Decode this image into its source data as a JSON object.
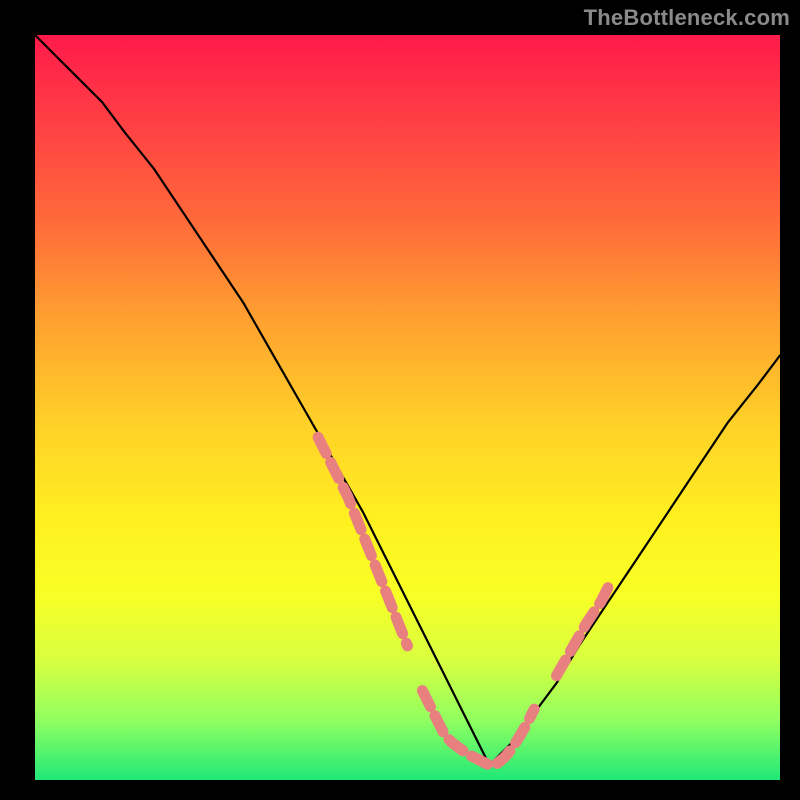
{
  "watermark": "TheBottleneck.com",
  "chart_data": {
    "type": "line",
    "title": "",
    "xlabel": "",
    "ylabel": "",
    "xlim": [
      0,
      100
    ],
    "ylim": [
      0,
      100
    ],
    "series": [
      {
        "name": "left-curve",
        "x": [
          0,
          3,
          6,
          9,
          12,
          16,
          20,
          24,
          28,
          32,
          36,
          40,
          44,
          48,
          52,
          55,
          57,
          59,
          61
        ],
        "y": [
          100,
          97,
          94,
          91,
          87,
          82,
          76,
          70,
          64,
          57,
          50,
          43,
          36,
          28,
          20,
          14,
          10,
          6,
          2
        ]
      },
      {
        "name": "right-curve",
        "x": [
          61,
          64,
          67,
          70,
          73,
          77,
          81,
          85,
          89,
          93,
          97,
          100
        ],
        "y": [
          2,
          5,
          9,
          13,
          18,
          24,
          30,
          36,
          42,
          48,
          53,
          57
        ]
      },
      {
        "name": "highlight-left-descent",
        "x": [
          38,
          40,
          42,
          44,
          46,
          48,
          50
        ],
        "y": [
          46,
          42,
          38,
          33,
          28,
          23,
          18
        ]
      },
      {
        "name": "highlight-valley",
        "x": [
          52,
          54,
          55,
          56,
          58,
          60,
          61,
          62,
          63,
          64,
          65,
          66,
          67
        ],
        "y": [
          12,
          8,
          6,
          5,
          3.5,
          2.5,
          2,
          2.2,
          3,
          4.2,
          5.8,
          7.5,
          9.5
        ]
      },
      {
        "name": "highlight-right-ascent",
        "x": [
          70,
          72,
          74,
          76,
          77
        ],
        "y": [
          14,
          17.5,
          21,
          24,
          26
        ]
      }
    ],
    "gradient_stops": [
      {
        "pos": 0,
        "color": "#ff1a4a"
      },
      {
        "pos": 10,
        "color": "#ff3a45"
      },
      {
        "pos": 25,
        "color": "#ff6a3a"
      },
      {
        "pos": 38,
        "color": "#ffa030"
      },
      {
        "pos": 52,
        "color": "#ffd028"
      },
      {
        "pos": 65,
        "color": "#fff020"
      },
      {
        "pos": 75,
        "color": "#f8ff25"
      },
      {
        "pos": 84,
        "color": "#d8ff40"
      },
      {
        "pos": 92,
        "color": "#90ff60"
      },
      {
        "pos": 100,
        "color": "#20e878"
      }
    ],
    "curve_color": "#000000",
    "highlight_color": "#e98080"
  }
}
